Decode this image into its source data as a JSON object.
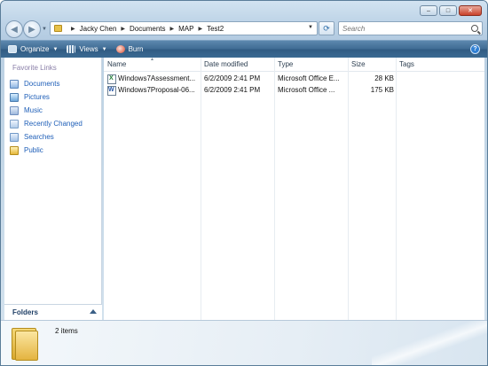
{
  "address": {
    "crumbs": [
      "Jacky Chen",
      "Documents",
      "MAP",
      "Test2"
    ]
  },
  "search": {
    "placeholder": "Search"
  },
  "toolbar": {
    "organize": "Organize",
    "views": "Views",
    "burn": "Burn",
    "help": "?"
  },
  "navpane": {
    "title": "Favorite Links",
    "items": [
      {
        "label": "Documents",
        "icon": "documents-icon"
      },
      {
        "label": "Pictures",
        "icon": "pictures-icon"
      },
      {
        "label": "Music",
        "icon": "music-icon"
      },
      {
        "label": "Recently Changed",
        "icon": "recently-changed-icon"
      },
      {
        "label": "Searches",
        "icon": "searches-icon"
      },
      {
        "label": "Public",
        "icon": "public-folder-icon"
      }
    ],
    "folders_label": "Folders"
  },
  "filelist": {
    "columns": [
      "Name",
      "Date modified",
      "Type",
      "Size",
      "Tags"
    ],
    "rows": [
      {
        "name": "Windows7Assessment...",
        "date": "6/2/2009 2:41 PM",
        "type": "Microsoft Office E...",
        "size": "28 KB",
        "icon": "excel-file-icon"
      },
      {
        "name": "Windows7Proposal-06...",
        "date": "6/2/2009 2:41 PM",
        "type": "Microsoft Office ...",
        "size": "175 KB",
        "icon": "word-file-icon"
      }
    ]
  },
  "details": {
    "count": "2 items"
  }
}
